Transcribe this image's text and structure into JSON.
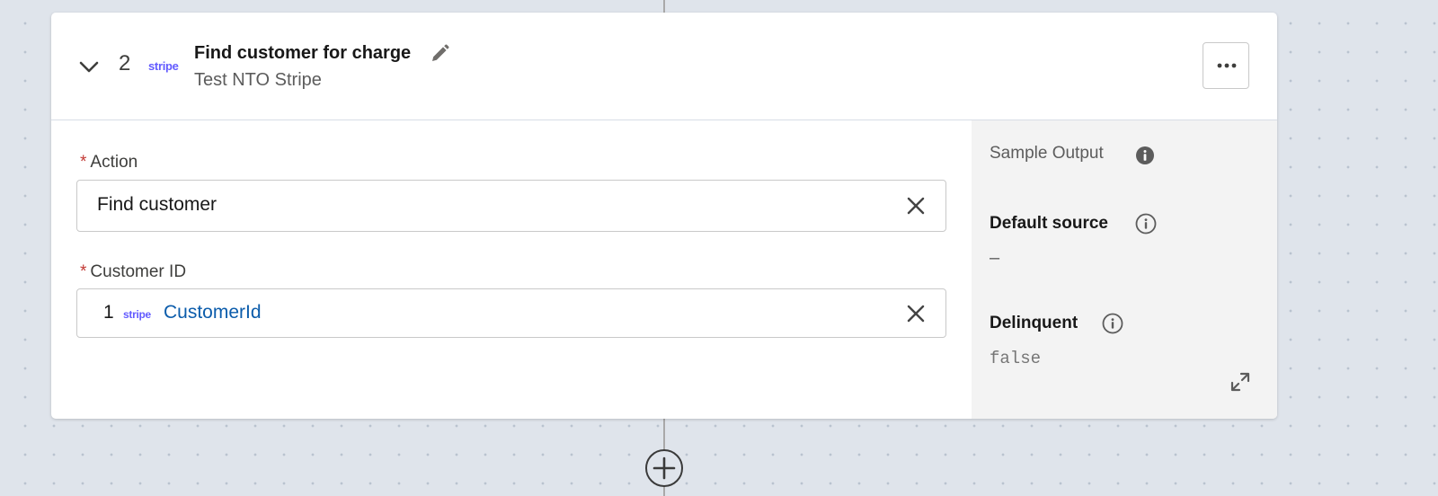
{
  "step": {
    "number": "2",
    "connector_logo": "stripe",
    "title": "Find customer for charge",
    "subtitle": "Test NTO Stripe",
    "icons": {
      "collapse": "chevron-down-icon",
      "edit": "pencil-icon",
      "more": "ellipsis-icon"
    }
  },
  "form": {
    "required_marker": "*",
    "action": {
      "label": "Action",
      "value": "Find customer"
    },
    "customer_id": {
      "label": "Customer ID",
      "source_step": "1",
      "source_logo": "stripe",
      "source_field": "CustomerId"
    }
  },
  "sample_output": {
    "title": "Sample Output",
    "fields": [
      {
        "name": "Default source",
        "value": "–"
      },
      {
        "name": "Delinquent",
        "value": "false"
      }
    ]
  },
  "colors": {
    "stripe": "#635bff",
    "link": "#0b5cab",
    "required": "#c23934",
    "canvas": "#dfe4eb"
  }
}
